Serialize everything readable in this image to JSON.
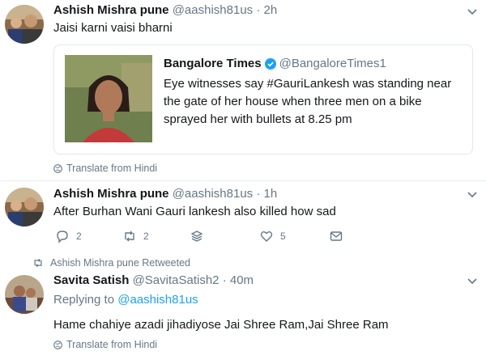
{
  "tweets": [
    {
      "name": "Ashish Mishra pune",
      "handle": "@aashish81us",
      "time": "· 2h",
      "text": "Jaisi karni vaisi bharni",
      "translate": "Translate from Hindi",
      "quote": {
        "name": "Bangalore Times",
        "handle": "@BangaloreTimes1",
        "text": "Eye witnesses say #GauriLankesh was standing near the gate of her house when three men on a bike sprayed her with bullets at 8.25 pm"
      }
    },
    {
      "name": "Ashish Mishra pune",
      "handle": "@aashish81us",
      "time": "· 1h",
      "text": "After Burhan Wani  Gauri lankesh also killed how sad",
      "actions": {
        "reply_count": "2",
        "retweet_count": "2",
        "like_count": "5"
      }
    },
    {
      "retweeted_by": "Ashish Mishra pune Retweeted",
      "name": "Savita Satish",
      "handle": "@SavitaSatish2",
      "time": "· 40m",
      "replying_prefix": "Replying to",
      "replying_to": "@aashish81us",
      "text": "Hame chahiye azadi jihadiyose Jai Shree Ram,Jai Shree Ram",
      "translate": "Translate from Hindi"
    }
  ],
  "colors": {
    "accent": "#1da1f2",
    "muted": "#657786",
    "text": "#14171a"
  }
}
